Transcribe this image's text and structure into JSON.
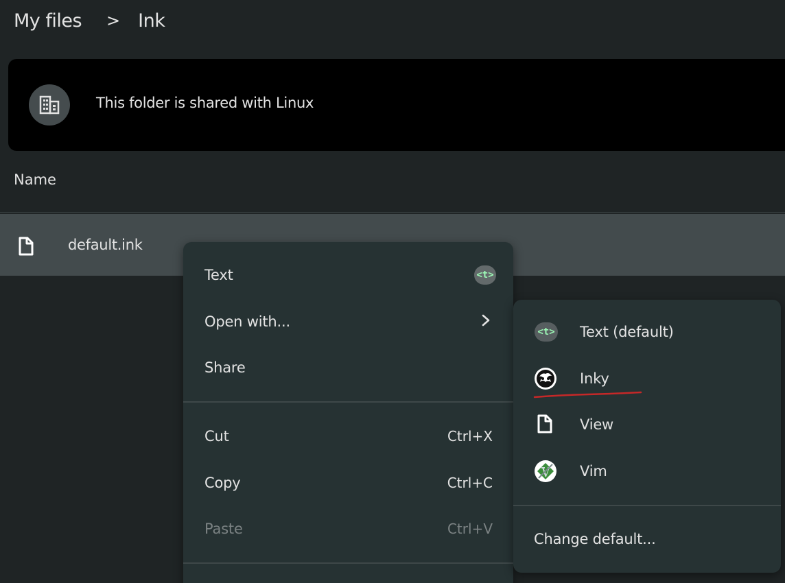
{
  "breadcrumb": {
    "root": "My files",
    "separator": ">",
    "current": "Ink"
  },
  "banner": {
    "icon": "building-icon",
    "text": "This folder is shared with Linux"
  },
  "file_list": {
    "column_header": "Name",
    "files": [
      {
        "name": "default.ink",
        "icon": "file-icon"
      }
    ]
  },
  "context_menu": {
    "items": [
      {
        "label": "Text",
        "badge": "<t>"
      },
      {
        "label": "Open with...",
        "icon": "chevron-right-icon"
      },
      {
        "label": "Share"
      },
      {
        "label": "Cut",
        "shortcut": "Ctrl+X"
      },
      {
        "label": "Copy",
        "shortcut": "Ctrl+C"
      },
      {
        "label": "Paste",
        "shortcut": "Ctrl+V",
        "disabled": true
      }
    ]
  },
  "open_with_submenu": {
    "items": [
      {
        "label": "Text (default)",
        "icon": "text-app-icon",
        "badge": "<t>"
      },
      {
        "label": "Inky",
        "icon": "inky-app-icon"
      },
      {
        "label": "View",
        "icon": "file-icon"
      },
      {
        "label": "Vim",
        "icon": "vim-app-icon"
      },
      {
        "label": "Change default..."
      }
    ]
  },
  "colors": {
    "background": "#1f2425",
    "banner": "#000000",
    "selected_row": "#434b4d",
    "menu": "#263233",
    "annotation_underline": "#c62828"
  }
}
